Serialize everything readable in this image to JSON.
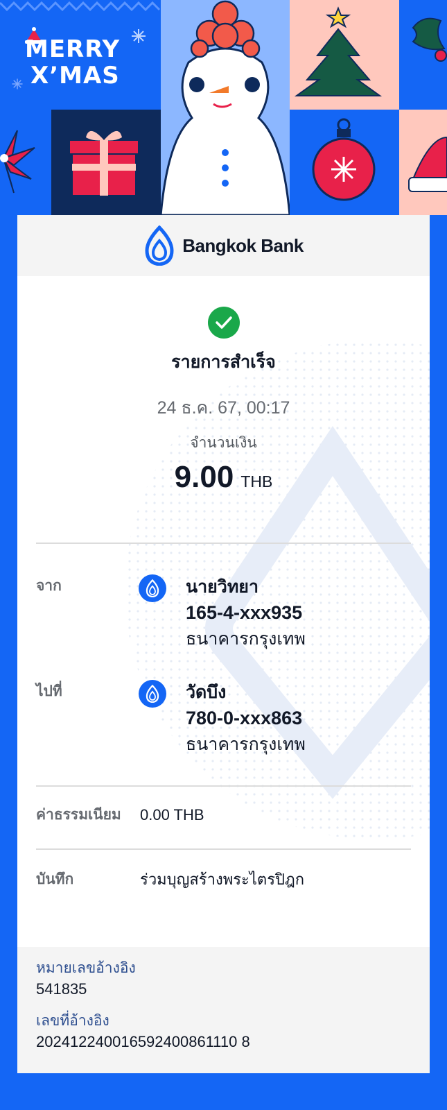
{
  "banner": {
    "title_line1": "MERRY",
    "title_line2": "X’MAS"
  },
  "header": {
    "bank_name": "Bangkok Bank"
  },
  "status": {
    "text": "รายการสำเร็จ",
    "datetime": "24 ธ.ค. 67, 00:17"
  },
  "amount": {
    "label": "จำนวนเงิน",
    "value": "9.00",
    "currency": "THB"
  },
  "from": {
    "label": "จาก",
    "name": "นายวิทยา",
    "account": "165-4-xxx935",
    "bank": "ธนาคารกรุงเทพ"
  },
  "to": {
    "label": "ไปที่",
    "name": "วัดบึง",
    "account": "780-0-xxx863",
    "bank": "ธนาคารกรุงเทพ"
  },
  "fee": {
    "label": "ค่าธรรมเนียม",
    "value": "0.00 THB"
  },
  "note": {
    "label": "บันทึก",
    "value": "ร่วมบุญสร้างพระไตรปิฎก"
  },
  "reference": {
    "ref1_label": "หมายเลขอ้างอิง",
    "ref1_value": "541835",
    "ref2_label": "เลขที่อ้างอิง",
    "ref2_value": "202412240016592400861110 8"
  },
  "colors": {
    "brand_blue": "#1466f5",
    "success_green": "#1aa84a"
  }
}
